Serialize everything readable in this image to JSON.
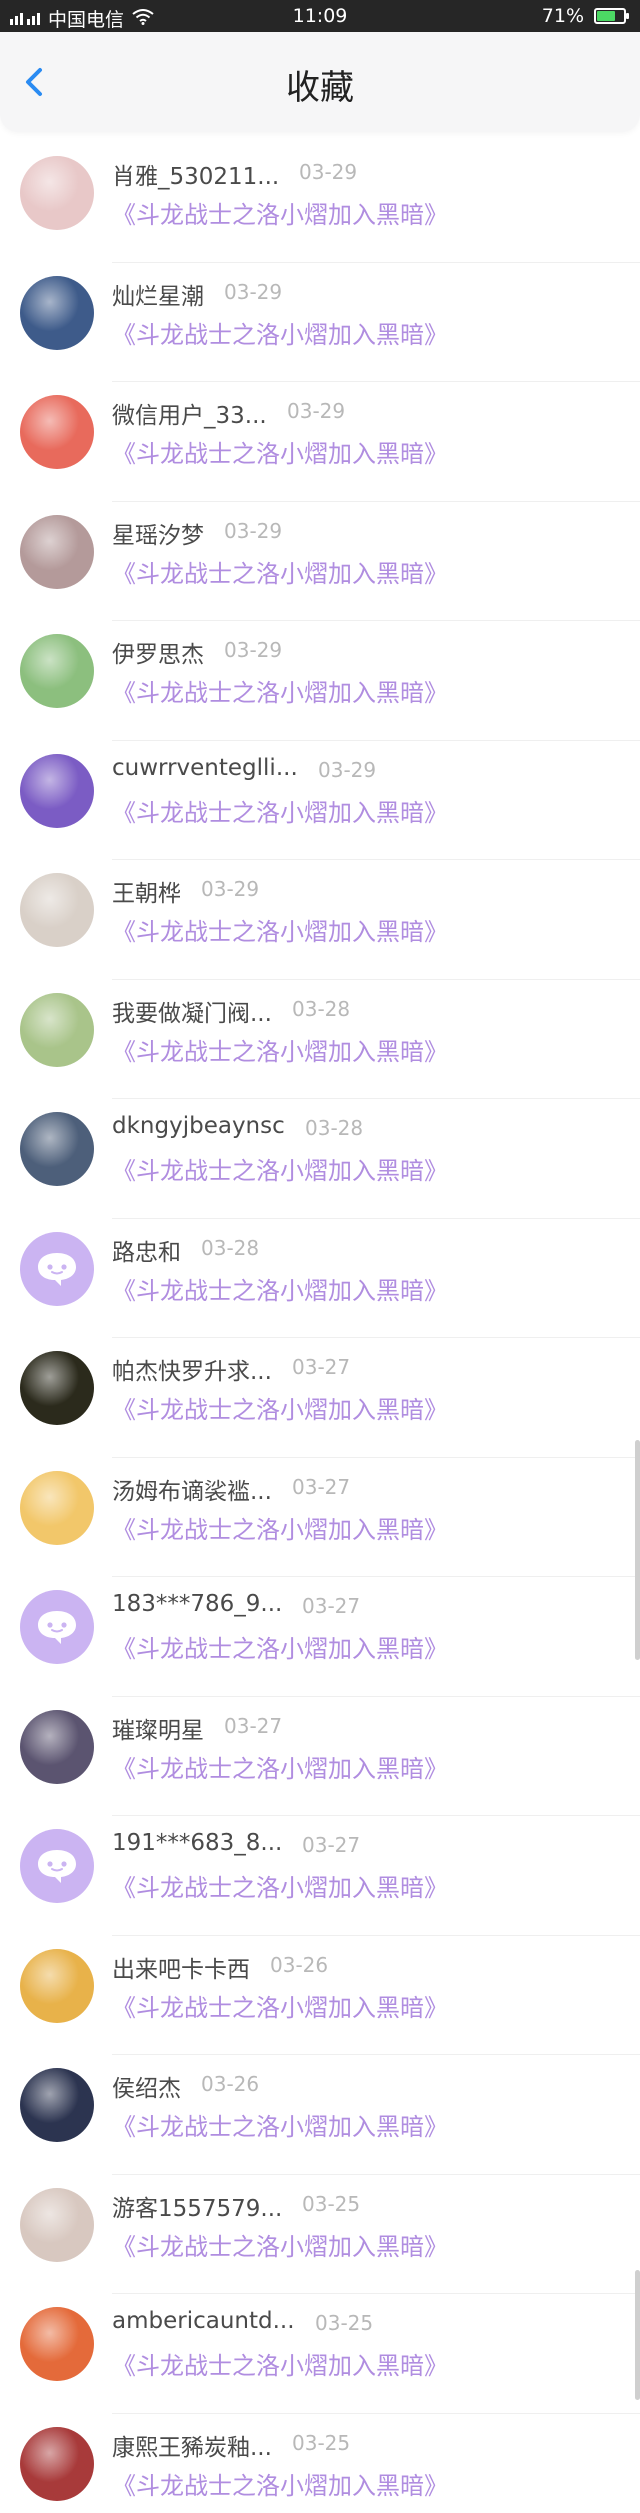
{
  "status_bar": {
    "carrier": "中国电信",
    "time": "11:09",
    "battery": "71%",
    "battery_level": 0.71
  },
  "header": {
    "title": "收藏"
  },
  "favorites": [
    {
      "name": "肖雅_530211...",
      "date": "03-29",
      "work": "《斗龙战士之洛小熠加入黑暗》",
      "avatar": "photo-avatar",
      "color": "#e8c8c8"
    },
    {
      "name": "灿烂星潮",
      "date": "03-29",
      "work": "《斗龙战士之洛小熠加入黑暗》",
      "avatar": "photo-avatar",
      "color": "#3e5b8a"
    },
    {
      "name": "微信用户_33...",
      "date": "03-29",
      "work": "《斗龙战士之洛小熠加入黑暗》",
      "avatar": "photo-avatar",
      "color": "#e86a5c"
    },
    {
      "name": "星瑶汐梦",
      "date": "03-29",
      "work": "《斗龙战士之洛小熠加入黑暗》",
      "avatar": "photo-avatar",
      "color": "#b49a9a"
    },
    {
      "name": "伊罗思杰",
      "date": "03-29",
      "work": "《斗龙战士之洛小熠加入黑暗》",
      "avatar": "photo-avatar",
      "color": "#8cbf7e"
    },
    {
      "name": "cuwrrventeglli...",
      "date": "03-29",
      "work": "《斗龙战士之洛小熠加入黑暗》",
      "avatar": "photo-avatar",
      "color": "#7b5cc4"
    },
    {
      "name": "王朝桦",
      "date": "03-29",
      "work": "《斗龙战士之洛小熠加入黑暗》",
      "avatar": "photo-avatar",
      "color": "#d9d0c8"
    },
    {
      "name": "我要做凝门阀...",
      "date": "03-28",
      "work": "《斗龙战士之洛小熠加入黑暗》",
      "avatar": "photo-avatar",
      "color": "#a9c48a"
    },
    {
      "name": "dkngyjbeaynsc",
      "date": "03-28",
      "work": "《斗龙战士之洛小熠加入黑暗》",
      "avatar": "photo-avatar",
      "color": "#4d5f7a"
    },
    {
      "name": "路忠和",
      "date": "03-28",
      "work": "《斗龙战士之洛小熠加入黑暗》",
      "avatar": "default-avatar",
      "color": "#cbb4f2"
    },
    {
      "name": "帕杰快罗升求...",
      "date": "03-27",
      "work": "《斗龙战士之洛小熠加入黑暗》",
      "avatar": "photo-avatar",
      "color": "#2b2a1c"
    },
    {
      "name": "汤姆布谪裟褴...",
      "date": "03-27",
      "work": "《斗龙战士之洛小熠加入黑暗》",
      "avatar": "photo-avatar",
      "color": "#f2c76a"
    },
    {
      "name": "183***786_9...",
      "date": "03-27",
      "work": "《斗龙战士之洛小熠加入黑暗》",
      "avatar": "default-avatar",
      "color": "#cbb4f2"
    },
    {
      "name": "璀璨明星",
      "date": "03-27",
      "work": "《斗龙战士之洛小熠加入黑暗》",
      "avatar": "photo-avatar",
      "color": "#5b5470"
    },
    {
      "name": "191***683_8...",
      "date": "03-27",
      "work": "《斗龙战士之洛小熠加入黑暗》",
      "avatar": "default-avatar",
      "color": "#cbb4f2"
    },
    {
      "name": "出来吧卡卡西",
      "date": "03-26",
      "work": "《斗龙战士之洛小熠加入黑暗》",
      "avatar": "photo-avatar",
      "color": "#e8b24a"
    },
    {
      "name": "侯绍杰",
      "date": "03-26",
      "work": "《斗龙战士之洛小熠加入黑暗》",
      "avatar": "photo-avatar",
      "color": "#2c3450"
    },
    {
      "name": "游客1557579...",
      "date": "03-25",
      "work": "《斗龙战士之洛小熠加入黑暗》",
      "avatar": "photo-avatar",
      "color": "#d8c8c0"
    },
    {
      "name": "ambericauntd...",
      "date": "03-25",
      "work": "《斗龙战士之洛小熠加入黑暗》",
      "avatar": "photo-avatar",
      "color": "#e46a3a"
    },
    {
      "name": "康熙王豨炭釉...",
      "date": "03-25",
      "work": "《斗龙战士之洛小熠加入黑暗》",
      "avatar": "photo-avatar",
      "color": "#a83a3a"
    }
  ]
}
